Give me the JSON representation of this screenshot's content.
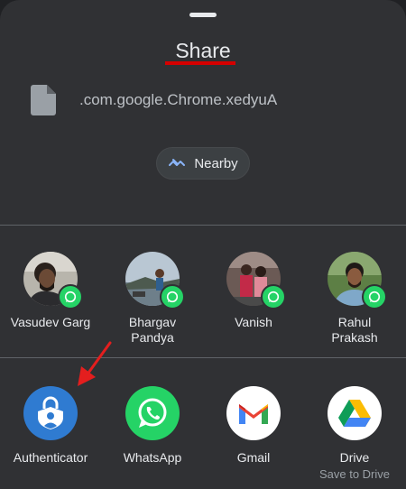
{
  "sheet": {
    "title": "Share",
    "file_name": ".com.google.Chrome.xedyuA",
    "nearby_label": "Nearby"
  },
  "contacts": [
    {
      "name_line1": "Vasudev Garg",
      "name_line2": "",
      "icon": "whatsapp-badge-icon"
    },
    {
      "name_line1": "Bhargav",
      "name_line2": "Pandya",
      "icon": "whatsapp-badge-icon"
    },
    {
      "name_line1": "Vanish",
      "name_line2": "",
      "icon": "whatsapp-badge-icon"
    },
    {
      "name_line1": "Rahul",
      "name_line2": "Prakash",
      "icon": "whatsapp-badge-icon"
    }
  ],
  "apps": [
    {
      "label": "Authenticator",
      "sublabel": "",
      "icon": "authenticator-icon"
    },
    {
      "label": "WhatsApp",
      "sublabel": "",
      "icon": "whatsapp-icon"
    },
    {
      "label": "Gmail",
      "sublabel": "",
      "icon": "gmail-icon"
    },
    {
      "label": "Drive",
      "sublabel": "Save to Drive",
      "icon": "drive-icon"
    }
  ],
  "colors": {
    "sheet_bg": "#303134",
    "accent_red": "#d50000",
    "whatsapp_green": "#25d366",
    "authenticator_blue": "#2f7bd1"
  }
}
